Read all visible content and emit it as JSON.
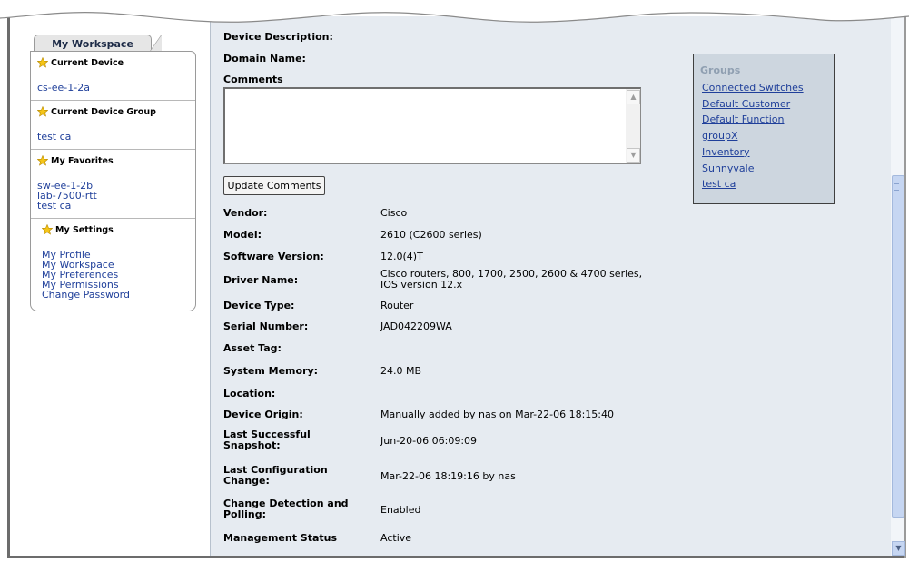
{
  "workspace": {
    "tab_label": "My Workspace",
    "current_device": {
      "title": "Current Device",
      "items": [
        "cs-ee-1-2a"
      ]
    },
    "current_device_group": {
      "title": "Current Device Group",
      "items": [
        "test ca"
      ]
    },
    "favorites": {
      "title": "My Favorites",
      "items": [
        "sw-ee-1-2b",
        "lab-7500-rtt",
        "test ca"
      ]
    },
    "settings": {
      "title": "My Settings",
      "items": [
        "My Profile",
        "My Workspace",
        "My Preferences",
        "My Permissions",
        "Change Password"
      ]
    }
  },
  "device": {
    "description_label": "Device Description:",
    "domain_label": "Domain Name:",
    "comments_label": "Comments",
    "comments_value": "",
    "update_button": "Update Comments",
    "fields": [
      {
        "label": "Vendor:",
        "value": "Cisco"
      },
      {
        "label": "Model:",
        "value": "2610 (C2600 series)"
      },
      {
        "label": "Software Version:",
        "value": "12.0(4)T"
      },
      {
        "label": "Driver Name:",
        "value": "Cisco routers, 800, 1700, 2500, 2600 & 4700 series,\nIOS version 12.x"
      },
      {
        "label": "Device Type:",
        "value": "Router"
      },
      {
        "label": "Serial Number:",
        "value": "JAD042209WA"
      },
      {
        "label": "Asset Tag:",
        "value": ""
      },
      {
        "label": "System Memory:",
        "value": "24.0 MB"
      },
      {
        "label": "Location:",
        "value": ""
      },
      {
        "label": "Device Origin:",
        "value": "Manually added by nas on Mar-22-06 18:15:40"
      },
      {
        "label": "Last Successful\nSnapshot:",
        "value": "Jun-20-06 06:09:09"
      },
      {
        "label": "Last Configuration\nChange:",
        "value": "Mar-22-06 18:19:16 by nas"
      },
      {
        "label": "Change Detection and\nPolling:",
        "value": "Enabled"
      },
      {
        "label": "Management Status",
        "value": "Active"
      }
    ]
  },
  "groups": {
    "title": "Groups",
    "items": [
      "Connected Switches",
      "Default Customer",
      "Default Function",
      "groupX",
      "Inventory",
      "Sunnyvale",
      "test ca"
    ]
  },
  "icons": {
    "favorite": "star-icon",
    "scroll_up": "arrow-up-icon",
    "scroll_down": "arrow-down-icon"
  },
  "colors": {
    "content_bg": "#e6ebf1",
    "groups_bg": "#cdd6df",
    "link": "#1f3f9a",
    "scroll_thumb": "#c6d6f2"
  }
}
